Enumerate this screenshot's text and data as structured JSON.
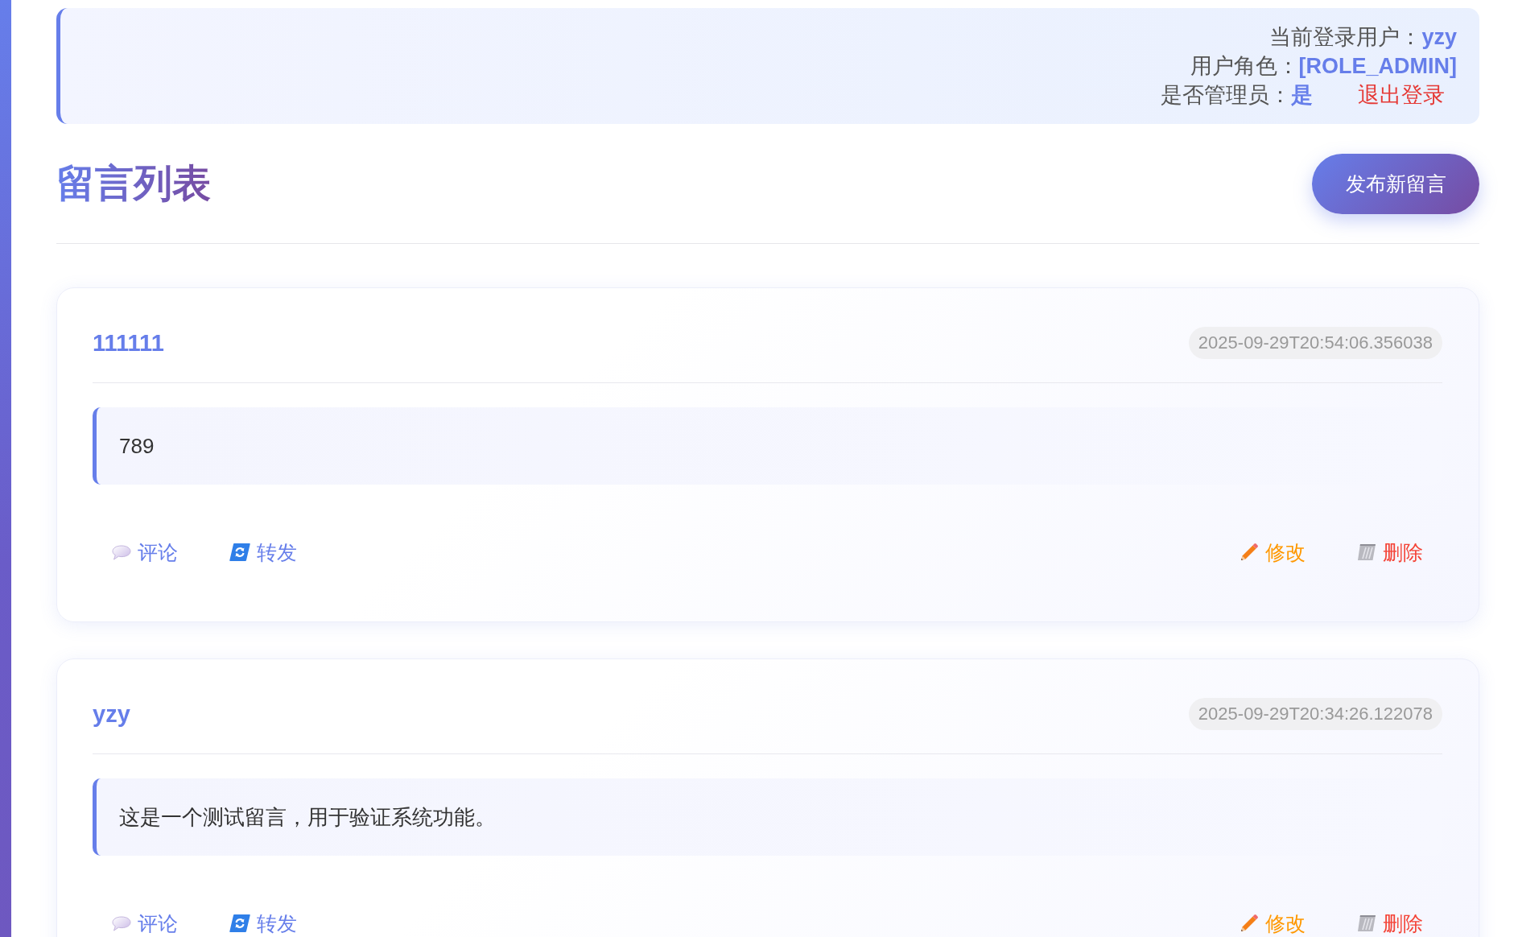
{
  "header": {
    "current_user": {
      "label": "当前登录用户：",
      "value": "yzy"
    },
    "role": {
      "label": "用户角色：",
      "value": "[ROLE_ADMIN]"
    },
    "is_admin": {
      "label": "是否管理员：",
      "value": "是"
    },
    "logout": "退出登录"
  },
  "page": {
    "title": "留言列表",
    "new_button": "发布新留言"
  },
  "messages": [
    {
      "author": "111111",
      "time": "2025-09-29T20:54:06.356038",
      "content": "789",
      "actions": [
        {
          "kind": "comment",
          "label": "评论"
        },
        {
          "kind": "forward",
          "label": "转发"
        },
        {
          "kind": "edit",
          "label": "修改"
        },
        {
          "kind": "delete",
          "label": "删除"
        }
      ]
    },
    {
      "author": "yzy",
      "time": "2025-09-29T20:34:26.122078",
      "content": "这是一个测试留言，用于验证系统功能。",
      "actions": [
        {
          "kind": "comment",
          "label": "评论"
        },
        {
          "kind": "forward",
          "label": "转发"
        },
        {
          "kind": "edit",
          "label": "修改"
        },
        {
          "kind": "delete",
          "label": "删除"
        }
      ]
    }
  ]
}
